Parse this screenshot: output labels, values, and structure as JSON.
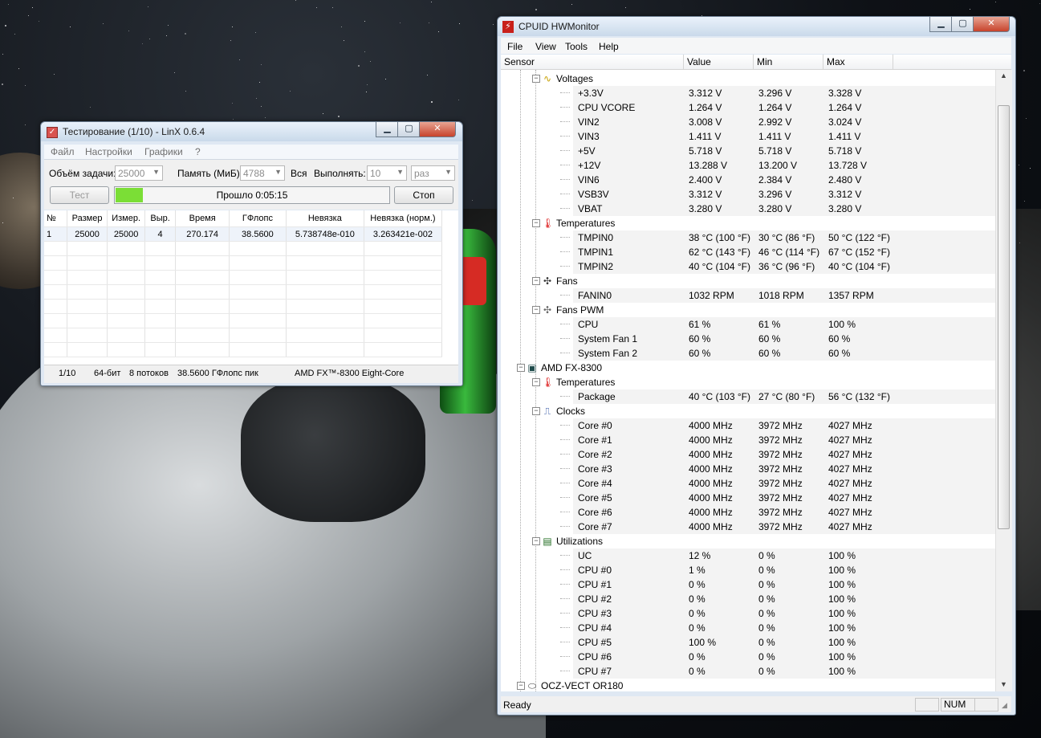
{
  "linx": {
    "title": "Тестирование (1/10) - LinX 0.6.4",
    "menu": [
      "Файл",
      "Настройки",
      "Графики",
      "?"
    ],
    "task_size_label": "Объём задачи:",
    "task_size_value": "25000",
    "memory_label": "Память (МиБ):",
    "memory_value": "4788",
    "all_label": "Вся",
    "run_label": "Выполнять:",
    "run_value": "10",
    "run_unit": "раз",
    "test_button": "Тест",
    "elapsed": "Прошло 0:05:15",
    "progress": 0.1,
    "stop_button": "Стоп",
    "table": {
      "headers": [
        "№",
        "Размер",
        "Измер.",
        "Выр.",
        "Время",
        "ГФлопс",
        "Невязка",
        "Невязка (норм.)"
      ],
      "rows": [
        [
          "1",
          "25000",
          "25000",
          "4",
          "270.174",
          "38.5600",
          "5.738748e-010",
          "3.263421e-002"
        ]
      ]
    },
    "status": {
      "run": "1/10",
      "bits": "64-бит",
      "threads": "8 потоков",
      "peak": "38.5600 ГФлопс пик",
      "cpu": "AMD FX™-8300 Eight-Core"
    }
  },
  "hwmonitor": {
    "title": "CPUID HWMonitor",
    "menu": [
      "File",
      "View",
      "Tools",
      "Help"
    ],
    "columns": [
      "Sensor",
      "Value",
      "Min",
      "Max"
    ],
    "status_text": "Ready",
    "status_num": "NUM",
    "rows": [
      {
        "level": 2,
        "type": "group",
        "icon": "voltage-icon",
        "glyph": "∿",
        "color": "#c7a000",
        "name": "Voltages"
      },
      {
        "level": 3,
        "name": "+3.3V",
        "value": "3.312 V",
        "min": "3.296 V",
        "max": "3.328 V"
      },
      {
        "level": 3,
        "name": "CPU VCORE",
        "value": "1.264 V",
        "min": "1.264 V",
        "max": "1.264 V"
      },
      {
        "level": 3,
        "name": "VIN2",
        "value": "3.008 V",
        "min": "2.992 V",
        "max": "3.024 V"
      },
      {
        "level": 3,
        "name": "VIN3",
        "value": "1.411 V",
        "min": "1.411 V",
        "max": "1.411 V"
      },
      {
        "level": 3,
        "name": "+5V",
        "value": "5.718 V",
        "min": "5.718 V",
        "max": "5.718 V"
      },
      {
        "level": 3,
        "name": "+12V",
        "value": "13.288 V",
        "min": "13.200 V",
        "max": "13.728 V"
      },
      {
        "level": 3,
        "name": "VIN6",
        "value": "2.400 V",
        "min": "2.384 V",
        "max": "2.480 V"
      },
      {
        "level": 3,
        "name": "VSB3V",
        "value": "3.312 V",
        "min": "3.296 V",
        "max": "3.312 V"
      },
      {
        "level": 3,
        "name": "VBAT",
        "value": "3.280 V",
        "min": "3.280 V",
        "max": "3.280 V"
      },
      {
        "level": 2,
        "type": "group",
        "icon": "thermometer-icon",
        "glyph": "🌡",
        "color": "#d22",
        "name": "Temperatures"
      },
      {
        "level": 3,
        "name": "TMPIN0",
        "value": "38 °C  (100 °F)",
        "min": "30 °C  (86 °F)",
        "max": "50 °C  (122 °F)"
      },
      {
        "level": 3,
        "name": "TMPIN1",
        "value": "62 °C  (143 °F)",
        "min": "46 °C  (114 °F)",
        "max": "67 °C  (152 °F)"
      },
      {
        "level": 3,
        "name": "TMPIN2",
        "value": "40 °C  (104 °F)",
        "min": "36 °C  (96 °F)",
        "max": "40 °C  (104 °F)"
      },
      {
        "level": 2,
        "type": "group",
        "icon": "fan-icon",
        "glyph": "✣",
        "color": "#333",
        "name": "Fans"
      },
      {
        "level": 3,
        "name": "FANIN0",
        "value": "1032 RPM",
        "min": "1018 RPM",
        "max": "1357 RPM"
      },
      {
        "level": 2,
        "type": "group",
        "icon": "fan-pwm-icon",
        "glyph": "✣",
        "color": "#666",
        "name": "Fans PWM"
      },
      {
        "level": 3,
        "name": "CPU",
        "value": "61 %",
        "min": "61 %",
        "max": "100 %"
      },
      {
        "level": 3,
        "name": "System Fan 1",
        "value": "60 %",
        "min": "60 %",
        "max": "60 %"
      },
      {
        "level": 3,
        "name": "System Fan 2",
        "value": "60 %",
        "min": "60 %",
        "max": "60 %"
      },
      {
        "level": 1,
        "type": "group",
        "icon": "cpu-chip-icon",
        "glyph": "▣",
        "color": "#1f4b4b",
        "name": "AMD FX-8300"
      },
      {
        "level": 2,
        "type": "group",
        "icon": "thermometer-icon",
        "glyph": "🌡",
        "color": "#d22",
        "name": "Temperatures"
      },
      {
        "level": 3,
        "name": "Package",
        "value": "40 °C  (103 °F)",
        "min": "27 °C  (80 °F)",
        "max": "56 °C  (132 °F)"
      },
      {
        "level": 2,
        "type": "group",
        "icon": "clock-icon",
        "glyph": "⎍",
        "color": "#2a4ea0",
        "name": "Clocks"
      },
      {
        "level": 3,
        "name": "Core #0",
        "value": "4000 MHz",
        "min": "3972 MHz",
        "max": "4027 MHz"
      },
      {
        "level": 3,
        "name": "Core #1",
        "value": "4000 MHz",
        "min": "3972 MHz",
        "max": "4027 MHz"
      },
      {
        "level": 3,
        "name": "Core #2",
        "value": "4000 MHz",
        "min": "3972 MHz",
        "max": "4027 MHz"
      },
      {
        "level": 3,
        "name": "Core #3",
        "value": "4000 MHz",
        "min": "3972 MHz",
        "max": "4027 MHz"
      },
      {
        "level": 3,
        "name": "Core #4",
        "value": "4000 MHz",
        "min": "3972 MHz",
        "max": "4027 MHz"
      },
      {
        "level": 3,
        "name": "Core #5",
        "value": "4000 MHz",
        "min": "3972 MHz",
        "max": "4027 MHz"
      },
      {
        "level": 3,
        "name": "Core #6",
        "value": "4000 MHz",
        "min": "3972 MHz",
        "max": "4027 MHz"
      },
      {
        "level": 3,
        "name": "Core #7",
        "value": "4000 MHz",
        "min": "3972 MHz",
        "max": "4027 MHz"
      },
      {
        "level": 2,
        "type": "group",
        "icon": "utilization-icon",
        "glyph": "▤",
        "color": "#1f6b1f",
        "name": "Utilizations"
      },
      {
        "level": 3,
        "name": "UC",
        "value": "12 %",
        "min": "0 %",
        "max": "100 %"
      },
      {
        "level": 3,
        "name": "CPU #0",
        "value": "1 %",
        "min": "0 %",
        "max": "100 %"
      },
      {
        "level": 3,
        "name": "CPU #1",
        "value": "0 %",
        "min": "0 %",
        "max": "100 %"
      },
      {
        "level": 3,
        "name": "CPU #2",
        "value": "0 %",
        "min": "0 %",
        "max": "100 %"
      },
      {
        "level": 3,
        "name": "CPU #3",
        "value": "0 %",
        "min": "0 %",
        "max": "100 %"
      },
      {
        "level": 3,
        "name": "CPU #4",
        "value": "0 %",
        "min": "0 %",
        "max": "100 %"
      },
      {
        "level": 3,
        "name": "CPU #5",
        "value": "100 %",
        "min": "0 %",
        "max": "100 %"
      },
      {
        "level": 3,
        "name": "CPU #6",
        "value": "0 %",
        "min": "0 %",
        "max": "100 %"
      },
      {
        "level": 3,
        "name": "CPU #7",
        "value": "0 %",
        "min": "0 %",
        "max": "100 %"
      },
      {
        "level": 1,
        "type": "group",
        "icon": "ssd-drive-icon",
        "glyph": "⬭",
        "color": "#444",
        "name": "OCZ-VECT OR180"
      }
    ]
  }
}
